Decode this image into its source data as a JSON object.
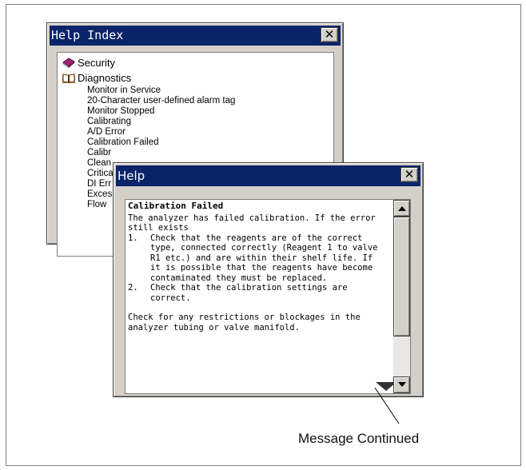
{
  "index_window": {
    "title": "Help Index",
    "close_label": "✕",
    "topics": [
      {
        "label": "Security",
        "icon": "closed-book-icon"
      },
      {
        "label": "Diagnostics",
        "icon": "open-book-icon"
      }
    ],
    "subtopics": [
      "Monitor in Service",
      "20-Character user-defined alarm tag",
      "Monitor Stopped",
      "Calibrating",
      "A/D Error",
      "Calibration Failed",
      "Calibr",
      "Clean",
      "Critica",
      "DI Err",
      "Exces",
      "Flow"
    ]
  },
  "help_window": {
    "title": "Help",
    "close_label": "✕",
    "heading": "Calibration Failed",
    "intro": "The analyzer has failed calibration. If the error still exists",
    "steps": [
      {
        "num": "1.",
        "text": "Check that the reagents are of the correct type, connected correctly (Reagent 1 to valve R1 etc.) and are within their shelf life. If it is possible that the reagents have become contaminated they must be replaced."
      },
      {
        "num": "2.",
        "text": "Check that the calibration settings are correct."
      }
    ],
    "footer": "Check for any restrictions or blockages in the analyzer tubing or valve manifold."
  },
  "callout": {
    "label": "Message Continued"
  },
  "colors": {
    "titlebar": "#0a246a",
    "face": "#d4d0c8"
  }
}
